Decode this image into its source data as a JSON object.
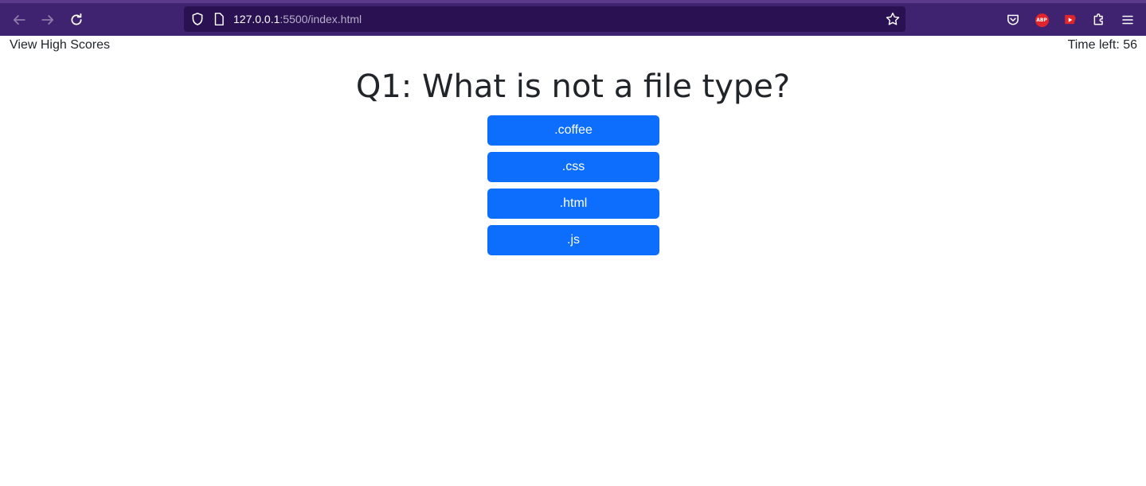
{
  "browser": {
    "url_host": "127.0.0.1",
    "url_path": ":5500/index.html"
  },
  "header": {
    "high_scores_label": "View High Scores",
    "timer_label": "Time left: 56"
  },
  "quiz": {
    "question": "Q1: What is not a file type?",
    "answers": [
      {
        "label": ".coffee"
      },
      {
        "label": ".css"
      },
      {
        "label": ".html"
      },
      {
        "label": ".js"
      }
    ]
  },
  "colors": {
    "toolbar": "#3f2270",
    "urlbar": "#2a1252",
    "answer_button": "#0d6efd",
    "text": "#212529"
  }
}
